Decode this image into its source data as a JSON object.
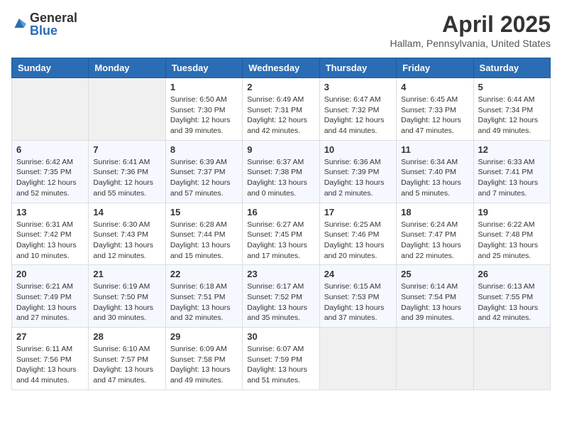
{
  "header": {
    "logo_general": "General",
    "logo_blue": "Blue",
    "title": "April 2025",
    "subtitle": "Hallam, Pennsylvania, United States"
  },
  "weekdays": [
    "Sunday",
    "Monday",
    "Tuesday",
    "Wednesday",
    "Thursday",
    "Friday",
    "Saturday"
  ],
  "weeks": [
    [
      {
        "day": "",
        "info": ""
      },
      {
        "day": "",
        "info": ""
      },
      {
        "day": "1",
        "info": "Sunrise: 6:50 AM\nSunset: 7:30 PM\nDaylight: 12 hours and 39 minutes."
      },
      {
        "day": "2",
        "info": "Sunrise: 6:49 AM\nSunset: 7:31 PM\nDaylight: 12 hours and 42 minutes."
      },
      {
        "day": "3",
        "info": "Sunrise: 6:47 AM\nSunset: 7:32 PM\nDaylight: 12 hours and 44 minutes."
      },
      {
        "day": "4",
        "info": "Sunrise: 6:45 AM\nSunset: 7:33 PM\nDaylight: 12 hours and 47 minutes."
      },
      {
        "day": "5",
        "info": "Sunrise: 6:44 AM\nSunset: 7:34 PM\nDaylight: 12 hours and 49 minutes."
      }
    ],
    [
      {
        "day": "6",
        "info": "Sunrise: 6:42 AM\nSunset: 7:35 PM\nDaylight: 12 hours and 52 minutes."
      },
      {
        "day": "7",
        "info": "Sunrise: 6:41 AM\nSunset: 7:36 PM\nDaylight: 12 hours and 55 minutes."
      },
      {
        "day": "8",
        "info": "Sunrise: 6:39 AM\nSunset: 7:37 PM\nDaylight: 12 hours and 57 minutes."
      },
      {
        "day": "9",
        "info": "Sunrise: 6:37 AM\nSunset: 7:38 PM\nDaylight: 13 hours and 0 minutes."
      },
      {
        "day": "10",
        "info": "Sunrise: 6:36 AM\nSunset: 7:39 PM\nDaylight: 13 hours and 2 minutes."
      },
      {
        "day": "11",
        "info": "Sunrise: 6:34 AM\nSunset: 7:40 PM\nDaylight: 13 hours and 5 minutes."
      },
      {
        "day": "12",
        "info": "Sunrise: 6:33 AM\nSunset: 7:41 PM\nDaylight: 13 hours and 7 minutes."
      }
    ],
    [
      {
        "day": "13",
        "info": "Sunrise: 6:31 AM\nSunset: 7:42 PM\nDaylight: 13 hours and 10 minutes."
      },
      {
        "day": "14",
        "info": "Sunrise: 6:30 AM\nSunset: 7:43 PM\nDaylight: 13 hours and 12 minutes."
      },
      {
        "day": "15",
        "info": "Sunrise: 6:28 AM\nSunset: 7:44 PM\nDaylight: 13 hours and 15 minutes."
      },
      {
        "day": "16",
        "info": "Sunrise: 6:27 AM\nSunset: 7:45 PM\nDaylight: 13 hours and 17 minutes."
      },
      {
        "day": "17",
        "info": "Sunrise: 6:25 AM\nSunset: 7:46 PM\nDaylight: 13 hours and 20 minutes."
      },
      {
        "day": "18",
        "info": "Sunrise: 6:24 AM\nSunset: 7:47 PM\nDaylight: 13 hours and 22 minutes."
      },
      {
        "day": "19",
        "info": "Sunrise: 6:22 AM\nSunset: 7:48 PM\nDaylight: 13 hours and 25 minutes."
      }
    ],
    [
      {
        "day": "20",
        "info": "Sunrise: 6:21 AM\nSunset: 7:49 PM\nDaylight: 13 hours and 27 minutes."
      },
      {
        "day": "21",
        "info": "Sunrise: 6:19 AM\nSunset: 7:50 PM\nDaylight: 13 hours and 30 minutes."
      },
      {
        "day": "22",
        "info": "Sunrise: 6:18 AM\nSunset: 7:51 PM\nDaylight: 13 hours and 32 minutes."
      },
      {
        "day": "23",
        "info": "Sunrise: 6:17 AM\nSunset: 7:52 PM\nDaylight: 13 hours and 35 minutes."
      },
      {
        "day": "24",
        "info": "Sunrise: 6:15 AM\nSunset: 7:53 PM\nDaylight: 13 hours and 37 minutes."
      },
      {
        "day": "25",
        "info": "Sunrise: 6:14 AM\nSunset: 7:54 PM\nDaylight: 13 hours and 39 minutes."
      },
      {
        "day": "26",
        "info": "Sunrise: 6:13 AM\nSunset: 7:55 PM\nDaylight: 13 hours and 42 minutes."
      }
    ],
    [
      {
        "day": "27",
        "info": "Sunrise: 6:11 AM\nSunset: 7:56 PM\nDaylight: 13 hours and 44 minutes."
      },
      {
        "day": "28",
        "info": "Sunrise: 6:10 AM\nSunset: 7:57 PM\nDaylight: 13 hours and 47 minutes."
      },
      {
        "day": "29",
        "info": "Sunrise: 6:09 AM\nSunset: 7:58 PM\nDaylight: 13 hours and 49 minutes."
      },
      {
        "day": "30",
        "info": "Sunrise: 6:07 AM\nSunset: 7:59 PM\nDaylight: 13 hours and 51 minutes."
      },
      {
        "day": "",
        "info": ""
      },
      {
        "day": "",
        "info": ""
      },
      {
        "day": "",
        "info": ""
      }
    ]
  ]
}
